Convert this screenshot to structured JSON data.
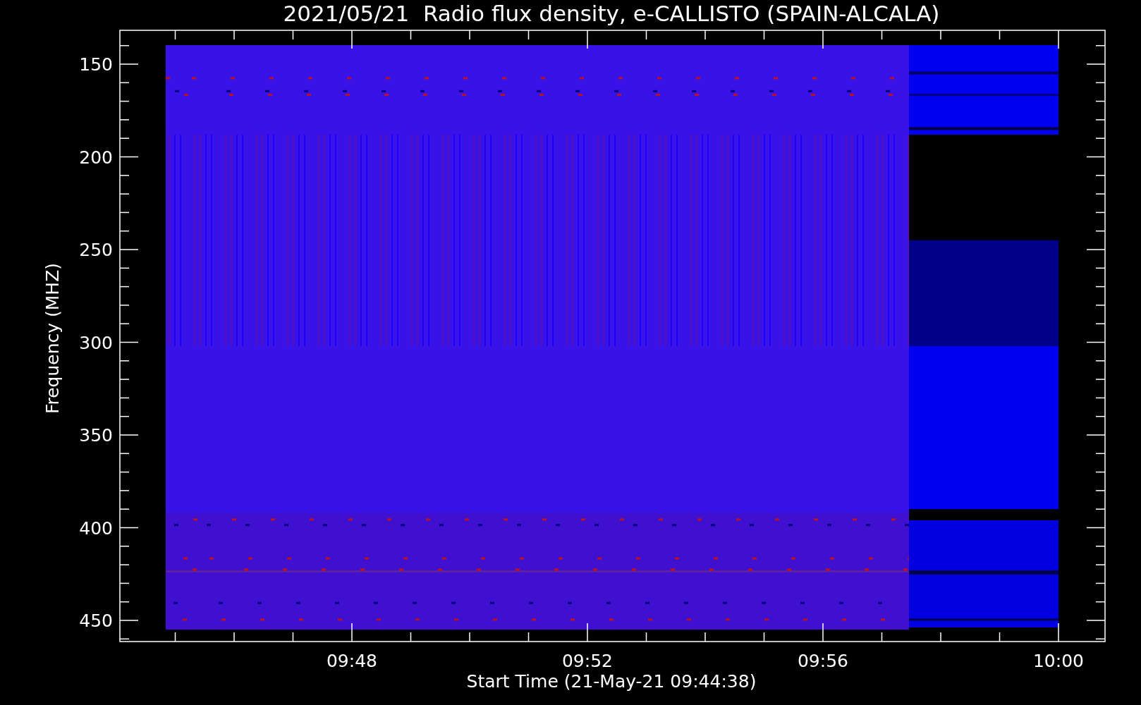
{
  "plot": {
    "title": "2021/05/21  Radio flux density, e-CALLISTO (SPAIN-ALCALA)",
    "ylabel": "Frequency (MHZ)",
    "xlabel": "Start Time (21-May-21 09:44:38)",
    "yticks": [
      "150",
      "200",
      "250",
      "300",
      "350",
      "400",
      "450"
    ],
    "xticks": [
      "09:48",
      "09:52",
      "09:56",
      "10:00"
    ]
  }
}
